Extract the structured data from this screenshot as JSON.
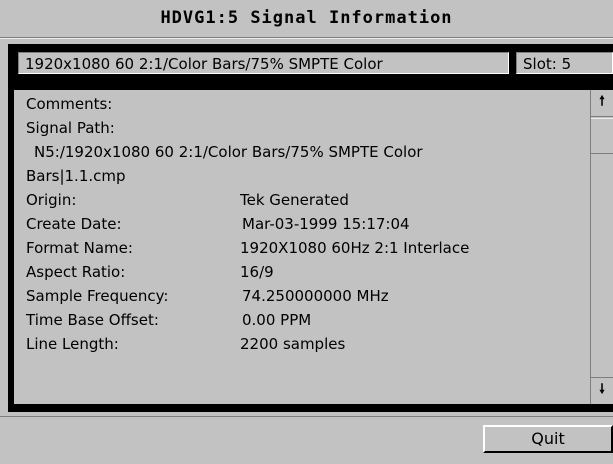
{
  "window": {
    "title": "HDVG1:5  Signal Information"
  },
  "infobar": {
    "format": "1920x1080  60 2:1/Color Bars/75% SMPTE  Color",
    "slot": "Slot: 5"
  },
  "info": {
    "comments_label": "Comments:",
    "signal_path_label": "Signal Path:",
    "signal_path_line1": "N5:/1920x1080  60 2:1/Color Bars/75% SMPTE  Color",
    "signal_path_line2": "Bars|1.1.cmp",
    "fields": [
      {
        "label": "Origin:",
        "value": "Tek Generated"
      },
      {
        "label": "Create Date:",
        "value": "Mar-03-1999  15:17:04"
      },
      {
        "label": "Format Name:",
        "value": "1920X1080 60Hz 2:1 Interlace"
      },
      {
        "label": "Aspect Ratio:",
        "value": "16/9"
      },
      {
        "label": "Sample Frequency:",
        "value": "74.250000000 MHz"
      },
      {
        "label": "Time Base Offset:",
        "value": "0.00 PPM"
      },
      {
        "label": "Line Length:",
        "value": "2200 samples"
      }
    ]
  },
  "scroll": {
    "up_icon": "arrow-up-icon",
    "down_icon": "arrow-down-icon"
  },
  "buttons": {
    "quit": "Quit"
  }
}
